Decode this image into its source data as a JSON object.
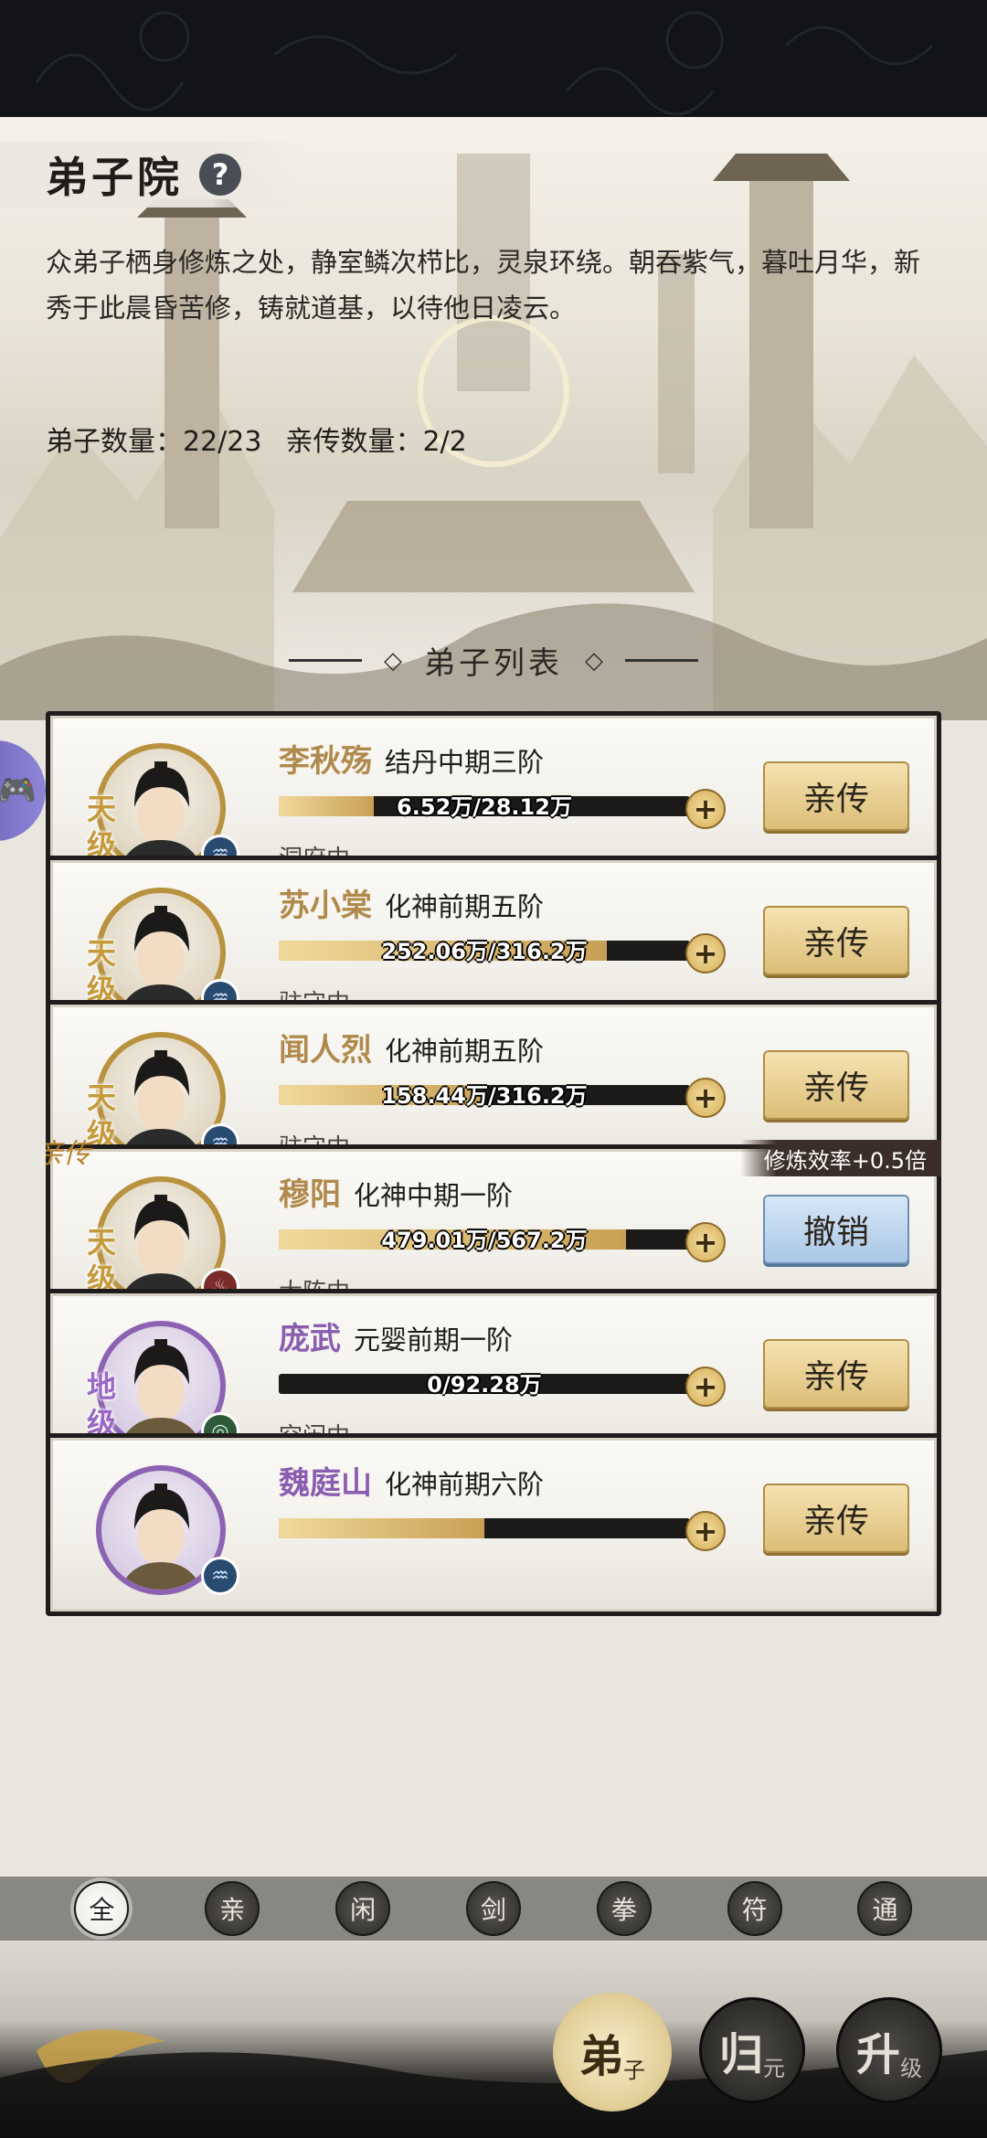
{
  "header": {
    "title": "弟子院",
    "help_icon": "?",
    "description": "众弟子栖身修炼之处，静室鳞次栉比，灵泉环绕。朝吞紫气，暮吐月华，新秀于此晨昏苦修，铸就道基，以待他日凌云。",
    "disciple_count_label": "弟子数量：22/23",
    "close_disciple_count_label": "亲传数量：2/2",
    "list_title": "弟子列表"
  },
  "disciples": [
    {
      "grade": "天级",
      "name": "李秋殇",
      "realm": "结丹中期三阶",
      "progress_text": "6.52万/28.12万",
      "progress": 0.232,
      "status": "洞府中...",
      "action": "亲传",
      "element_icon": "water-icon",
      "is_close": false
    },
    {
      "grade": "天级",
      "name": "苏小棠",
      "realm": "化神前期五阶",
      "progress_text": "252.06万/316.2万",
      "progress": 0.797,
      "status": "驻守中...",
      "action": "亲传",
      "element_icon": "water-icon",
      "is_close": false
    },
    {
      "grade": "天级",
      "name": "闻人烈",
      "realm": "化神前期五阶",
      "progress_text": "158.44万/316.2万",
      "progress": 0.501,
      "status": "驻守中...",
      "action": "亲传",
      "element_icon": "water-icon",
      "is_close": false
    },
    {
      "grade": "天级",
      "name": "穆阳",
      "realm": "化神中期一阶",
      "progress_text": "479.01万/567.2万",
      "progress": 0.845,
      "status": "大阵中...",
      "action": "撤销",
      "element_icon": "fire-icon",
      "is_close": true,
      "close_tag": "亲传",
      "efficiency": "修炼效率+0.5倍"
    },
    {
      "grade": "地级",
      "name": "庞武",
      "realm": "元婴前期一阶",
      "progress_text": "0/92.28万",
      "progress": 0.0,
      "status": "空闲中...",
      "action": "亲传",
      "element_icon": "wind-icon",
      "is_close": false
    },
    {
      "grade": "",
      "name": "魏庭山",
      "realm": "化神前期六阶",
      "progress_text": "",
      "progress": 0.5,
      "status": "",
      "action": "亲传",
      "element_icon": "water-icon",
      "is_close": false
    }
  ],
  "filters": [
    "全",
    "亲",
    "闲",
    "剑",
    "拳",
    "符",
    "通"
  ],
  "active_filter": "全",
  "nav": [
    {
      "id": "disciple",
      "big": "弟",
      "small": "子",
      "active": true
    },
    {
      "id": "return",
      "big": "归",
      "small": "元",
      "active": false
    },
    {
      "id": "upgrade",
      "big": "升",
      "small": "级",
      "active": false
    }
  ],
  "floating": {
    "gamepad_icon": "🎮"
  },
  "colors": {
    "gold": "#b08a4c",
    "purple": "#8a5db0",
    "blue_button": "#a9c7e6"
  }
}
